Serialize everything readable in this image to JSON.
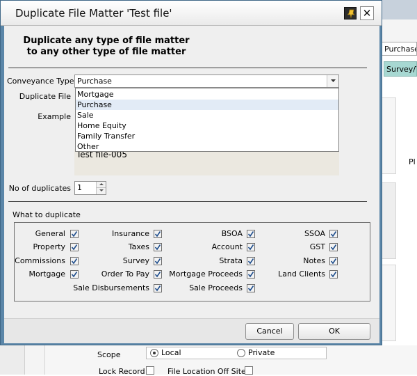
{
  "background": {
    "field_value": "Purchase",
    "tab_label": "Survey/T",
    "side_text": "Pl",
    "scope": {
      "label": "Scope",
      "options": [
        "Local",
        "Private"
      ],
      "selected": "Local"
    },
    "lock_record": {
      "label": "Lock Record",
      "checked": false
    },
    "file_location": {
      "label": "File Location Off Site",
      "checked": false
    }
  },
  "dialog": {
    "title": "Duplicate File Matter 'Test file'",
    "heading_line1": "Duplicate any type of file matter",
    "heading_line2": "to any other type of file matter",
    "conveyance_type": {
      "label": "Conveyance Type",
      "value": "Purchase",
      "options": [
        "Mortgage",
        "Purchase",
        "Sale",
        "Home Equity",
        "Family Transfer",
        "Other"
      ],
      "highlighted": "Purchase"
    },
    "duplicate_file_label": "Duplicate File",
    "example_label": "Example",
    "example_value": "Test file-005",
    "no_of_duplicates": {
      "label": "No of duplicates",
      "value": "1"
    },
    "what_to_duplicate": {
      "label": "What to duplicate",
      "items": [
        {
          "label": "General",
          "checked": true
        },
        {
          "label": "Insurance",
          "checked": true
        },
        {
          "label": "BSOA",
          "checked": true
        },
        {
          "label": "SSOA",
          "checked": true
        },
        {
          "label": "Property",
          "checked": true
        },
        {
          "label": "Taxes",
          "checked": true
        },
        {
          "label": "Account",
          "checked": true
        },
        {
          "label": "GST",
          "checked": true
        },
        {
          "label": "Commissions",
          "checked": true
        },
        {
          "label": "Survey",
          "checked": true
        },
        {
          "label": "Strata",
          "checked": true
        },
        {
          "label": "Notes",
          "checked": true
        },
        {
          "label": "Mortgage",
          "checked": true
        },
        {
          "label": "Order To Pay",
          "checked": true
        },
        {
          "label": "Mortgage Proceeds",
          "checked": true
        },
        {
          "label": "Land Clients",
          "checked": true
        },
        {
          "label": "Sale Disbursements",
          "checked": true
        },
        {
          "label": "Sale Proceeds",
          "checked": true
        }
      ]
    },
    "buttons": {
      "cancel": "Cancel",
      "ok": "OK"
    },
    "colors": {
      "frame": "#5b86a8",
      "selection": "#e2ebf6",
      "tab_accent": "#a7d8d2"
    },
    "icons": {
      "pin": "pin-icon",
      "close": "close-icon"
    }
  }
}
